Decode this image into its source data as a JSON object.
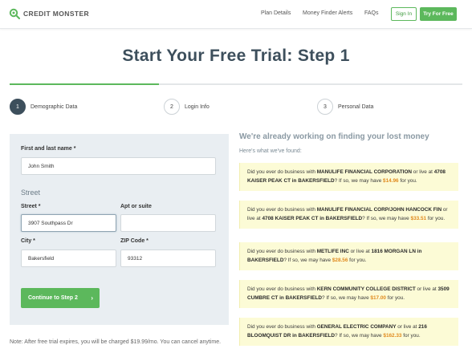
{
  "header": {
    "logo_text": "CREDIT MONSTER",
    "nav": [
      "Plan Details",
      "Money Finder Alerts",
      "FAQs"
    ],
    "signin_label": "Sign In",
    "try_label": "Try For Free"
  },
  "title": "Start Your Free Trial: Step 1",
  "progress_fraction": 0.33,
  "steps": [
    {
      "num": "1",
      "label": "Demographic Data"
    },
    {
      "num": "2",
      "label": "Login Info"
    },
    {
      "num": "3",
      "label": "Personal Data"
    }
  ],
  "form": {
    "name_label": "First and last name *",
    "name_value": "John Smith",
    "street_section": "Street",
    "street_label": "Street *",
    "street_value": "3907 Southpass Dr",
    "apt_label": "Apt or suite",
    "apt_value": "",
    "city_label": "City *",
    "city_value": "Bakersfield",
    "zip_label": "ZIP Code *",
    "zip_value": "93312",
    "continue_label": "Continue to Step 2",
    "continue_chevron": "›"
  },
  "note": "Note: After free trial expires, you will be charged $19.99/mo. You can cancel anytime.",
  "results": {
    "heading": "We're already working on finding your lost money",
    "subheading": "Here's what we've found:",
    "items": [
      {
        "p1": "Did you ever do business with ",
        "company": "MANULIFE FINANCIAL CORPORATION",
        "p2": " or live at ",
        "address": "4708 KAISER PEAK CT in BAKERSFIELD",
        "p3": "? If so, we may have ",
        "amount": "$14.96",
        "p4": " for you."
      },
      {
        "p1": "Did you ever do business with ",
        "company": "MANULIFE FINANCIAL CORP/JOHN HANCOCK FIN",
        "p2": " or live at ",
        "address": "4708 KAISER PEAK CT in BAKERSFIELD",
        "p3": "? If so, we may have ",
        "amount": "$33.51",
        "p4": " for you."
      },
      {
        "p1": "Did you ever do business with ",
        "company": "METLIFE INC",
        "p2": " or live at ",
        "address": "1816 MORGAN LN in BAKERSFIELD",
        "p3": "? If so, we may have ",
        "amount": "$28.56",
        "p4": " for you."
      },
      {
        "p1": "Did you ever do business with ",
        "company": "KERN COMMUNITY COLLEGE DISTRICT",
        "p2": " or live at ",
        "address": "3509 CUMBRE CT in BAKERSFIELD",
        "p3": "? If so, we may have ",
        "amount": "$17.00",
        "p4": " for you."
      },
      {
        "p1": "Did you ever do business with ",
        "company": "GENERAL ELECTRIC COMPANY",
        "p2": " or live at ",
        "address": "216 BLOOMQUIST DR in BAKERSFIELD",
        "p3": "? If so, we may have ",
        "amount": "$162.33",
        "p4": " for you."
      }
    ]
  },
  "colors": {
    "accent": "#5cb85c",
    "title": "#3d4f5c",
    "highlight": "#fcfbd6",
    "amount": "#e08a1e"
  }
}
